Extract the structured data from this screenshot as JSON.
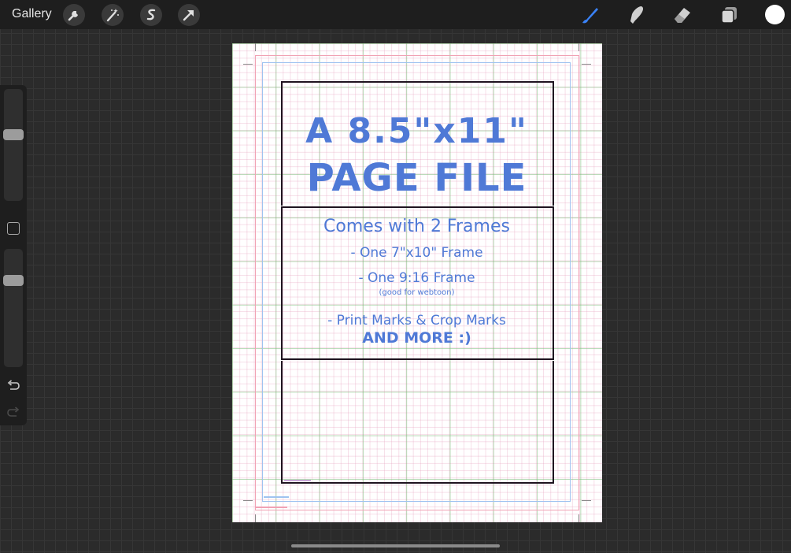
{
  "toolbar": {
    "gallery_label": "Gallery",
    "left_tools": [
      "wrench-icon",
      "magic-wand-icon",
      "selection-icon",
      "transform-arrow-icon"
    ],
    "right_tools": [
      "brush-icon",
      "smudge-icon",
      "eraser-icon",
      "layers-icon"
    ],
    "active_tool": "brush-icon",
    "accent_color": "#3a82f7",
    "current_color": "#ffffff"
  },
  "sidebar": {
    "brush_size_level": 0.6,
    "opacity_level": 0.76,
    "buttons": [
      "modify-button",
      "undo-icon",
      "redo-icon"
    ]
  },
  "canvas": {
    "title_line1": "A 8.5\"x11\"",
    "title_line2": "PAGE FILE",
    "subheading": "Comes with 2 Frames",
    "bullet1": "- One 7\"x10\" Frame",
    "bullet2": "- One 9:16 Frame",
    "bullet2_note": "(good for webtoon)",
    "bullet3": "- Print Marks & Crop Marks",
    "closing": "AND MORE :)",
    "hand_color": "#4f79d6",
    "frame_color": "#1f1420"
  }
}
